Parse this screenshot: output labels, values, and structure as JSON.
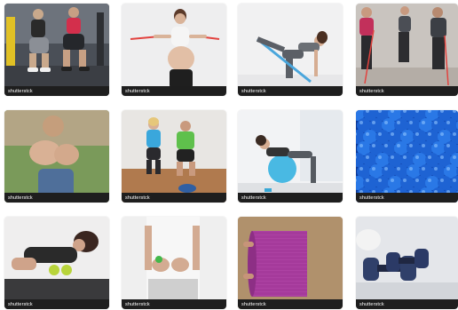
{
  "gallery": {
    "watermark_label": "shutterstck",
    "tiles": [
      {
        "name": "tile-gym-squats-group",
        "icon": "photo-gym-squats"
      },
      {
        "name": "tile-pregnant-woman-resistance-band",
        "icon": "photo-pregnant-band"
      },
      {
        "name": "tile-woman-kneeling-band-stretch",
        "icon": "photo-kneeling-band"
      },
      {
        "name": "tile-group-resistance-band-class",
        "icon": "photo-group-bands"
      },
      {
        "name": "tile-hands-closeup-outdoors",
        "icon": "photo-hands-outdoor"
      },
      {
        "name": "tile-couple-squats-home",
        "icon": "photo-couple-squat"
      },
      {
        "name": "tile-woman-fitness-ball",
        "icon": "photo-fitness-ball"
      },
      {
        "name": "tile-blue-balls-pit",
        "icon": "photo-blue-balls"
      },
      {
        "name": "tile-woman-massage-balls-mat",
        "icon": "photo-massage-balls"
      },
      {
        "name": "tile-hands-green-ball",
        "icon": "photo-hands-ball"
      },
      {
        "name": "tile-purple-yoga-mat",
        "icon": "photo-yoga-mat"
      },
      {
        "name": "tile-blue-dumbbells",
        "icon": "photo-dumbbells"
      }
    ]
  }
}
